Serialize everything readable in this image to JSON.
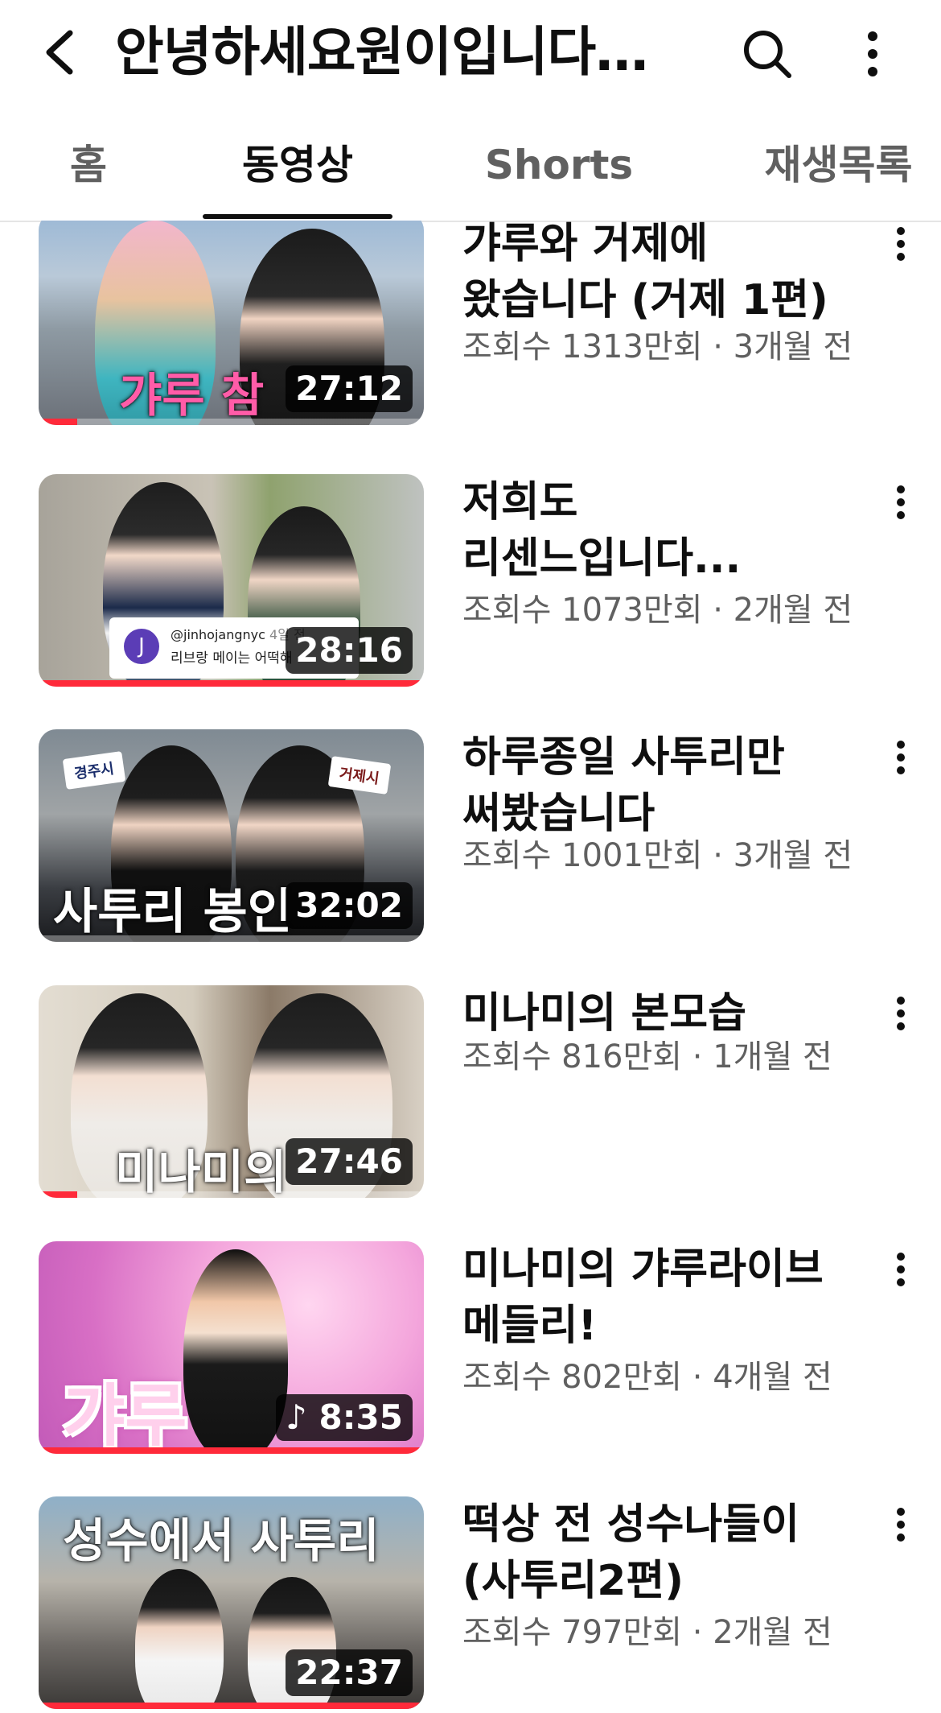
{
  "header": {
    "title": "안녕하세요원이입니다…",
    "back_icon": "chevron-left-icon",
    "search_icon": "search-icon",
    "more_icon": "more-vertical-icon"
  },
  "tabs": [
    {
      "label": "홈",
      "active": false
    },
    {
      "label": "동영상",
      "active": true
    },
    {
      "label": "Shorts",
      "active": false
    },
    {
      "label": "재생목록",
      "active": false
    }
  ],
  "colors": {
    "progress": "#ff2a3a",
    "text_primary": "#0f0f0f",
    "text_secondary": "#606060"
  },
  "videos": [
    {
      "title": "갸루와 거제에 왔습니다 (거제 1편)",
      "meta": "조회수 1313만회 · 3개월 전",
      "duration": "27:12",
      "thumb_overlay": "갸루 참",
      "watched_fraction": 0.1
    },
    {
      "title": "저희도 리센느입니다...",
      "meta": "조회수 1073만회 · 2개월 전",
      "duration": "28:16",
      "comment_handle": "@jinhojangnyc",
      "comment_time": "4일 전",
      "comment_text": "리브랑 메이는 어떡해",
      "comment_avatar": "J",
      "watched_fraction": 1.0
    },
    {
      "title": "하루종일 사투리만 써봤습니다",
      "meta": "조회수 1001만회 · 3개월 전",
      "duration": "32:02",
      "thumb_overlay": "사투리 봉인",
      "sign_left": "경주시",
      "sign_right": "거제시",
      "watched_fraction": 0.0
    },
    {
      "title": "미나미의 본모습",
      "meta": "조회수 816만회 · 1개월 전",
      "duration": "27:46",
      "thumb_overlay": "미나미의",
      "watched_fraction": 0.1
    },
    {
      "title": "미나미의 갸루라이브 메들리!",
      "meta": "조회수 802만회 · 4개월 전",
      "duration": "8:35",
      "duration_icon": "music-note-icon",
      "thumb_overlay": "갸루",
      "watched_fraction": 1.0
    },
    {
      "title": "떡상 전 성수나들이 (사투리2편)",
      "meta": "조회수 797만회 · 2개월 전",
      "duration": "22:37",
      "thumb_overlay": "성수에서 사투리",
      "watched_fraction": 1.0
    }
  ]
}
